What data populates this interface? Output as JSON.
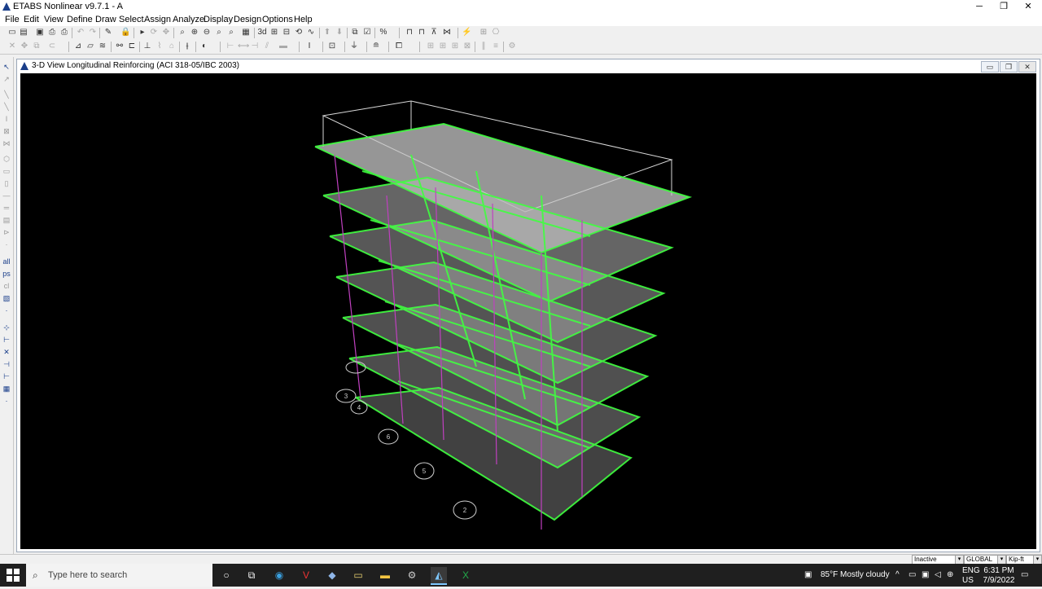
{
  "window": {
    "title": "ETABS Nonlinear v9.7.1 - A",
    "minimize": "─",
    "maximize": "❐",
    "close": "✕"
  },
  "menu": [
    "File",
    "Edit",
    "View",
    "Define",
    "Draw",
    "Select",
    "Assign",
    "Analyze",
    "Display",
    "Design",
    "Options",
    "Help"
  ],
  "toolbar1": [
    "new-icon",
    "open-icon",
    "save-icon",
    "print-icon",
    "print-setup-icon",
    "undo-icon",
    "redo-icon",
    "edit-pencil-icon",
    "lock-icon",
    "run-icon",
    "refresh-icon",
    "pan-icon",
    "zoom-window-icon",
    "zoom-in-icon",
    "zoom-out-icon",
    "zoom-previous-icon",
    "zoom-extents-icon",
    "3d-view-icon",
    "plan-view-icon",
    "elevation-view-icon",
    "rotate-icon",
    "perspective-icon",
    "move-up-icon",
    "move-down-icon",
    "object-shrink-icon",
    "set-display-icon",
    "display-options-icon",
    "frame-icon",
    "frame-b-icon",
    "truss-icon",
    "lightning-icon",
    "grid-icon",
    "misc-icon"
  ],
  "view_window": {
    "title": "3-D View  Longitudinal Reinforcing  (ACI 318-05/IBC 2003)",
    "bg_color": "#000000",
    "overlay_color": "#40ff40",
    "grid_bubbles": [
      "6",
      "5",
      "4",
      "3",
      "2"
    ]
  },
  "statusbar": {
    "mode": "Inactive",
    "coord_system": "GLOBAL",
    "units": "Kip-ft"
  },
  "taskbar": {
    "search_placeholder": "Type here to search",
    "weather": "85°F  Mostly cloudy",
    "lang": "ENG",
    "region": "US",
    "time": "6:31 PM",
    "date": "7/9/2022"
  }
}
